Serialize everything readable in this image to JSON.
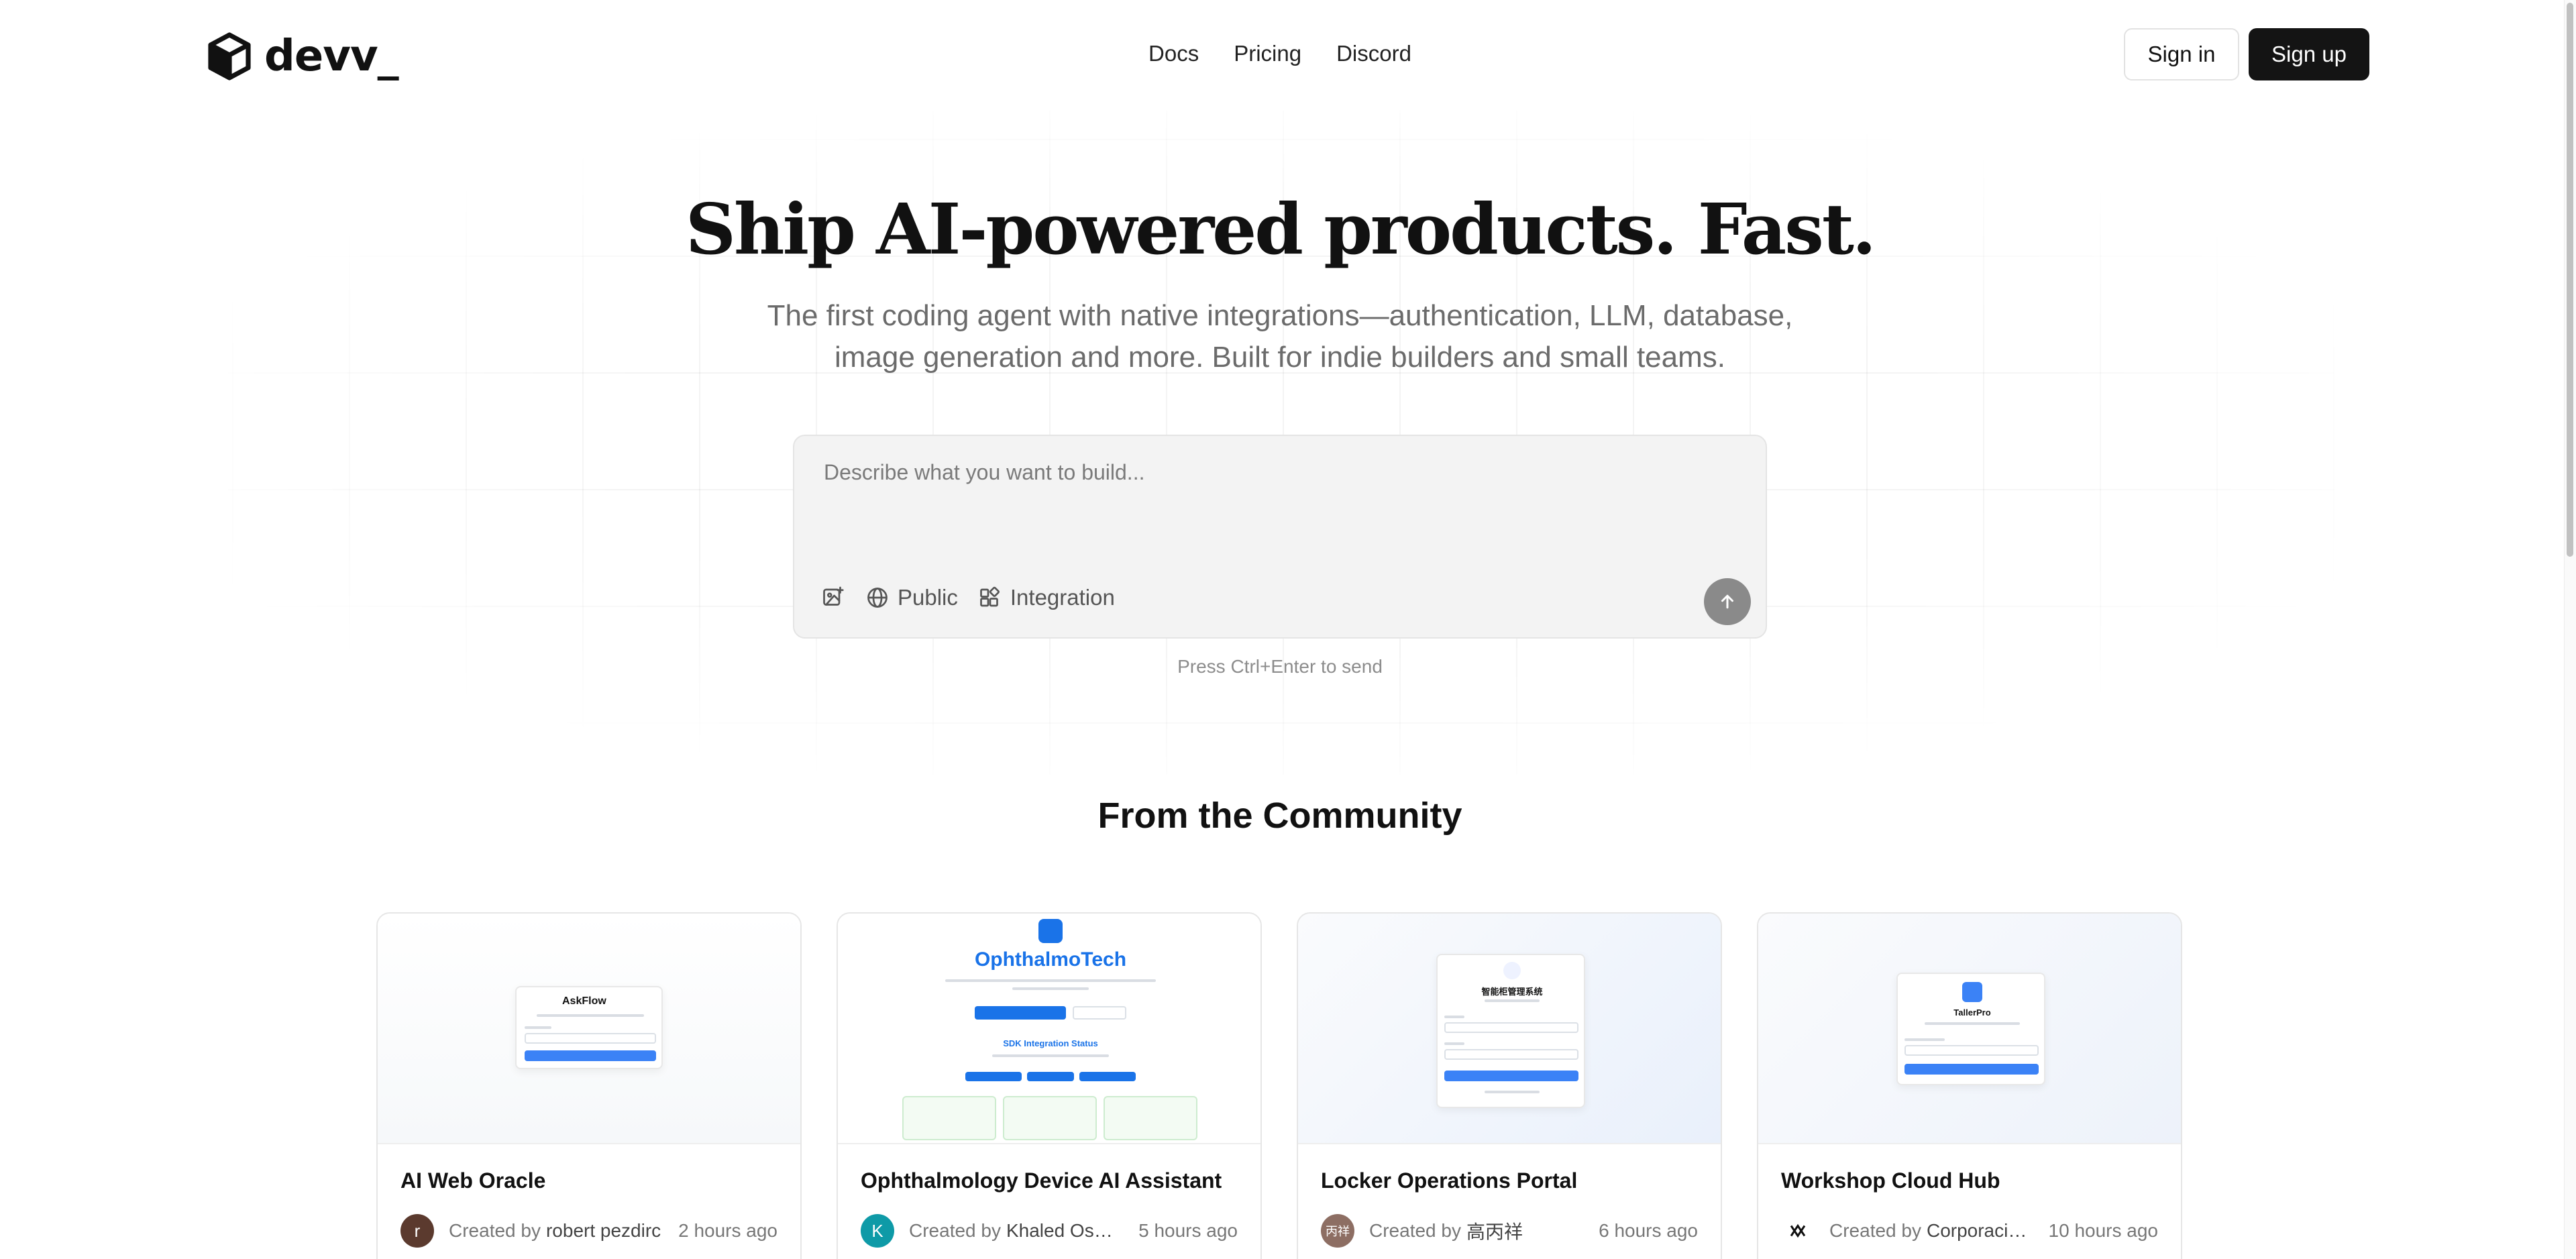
{
  "header": {
    "logo_text": "devv_",
    "nav": [
      "Docs",
      "Pricing",
      "Discord"
    ],
    "sign_in": "Sign in",
    "sign_up": "Sign up"
  },
  "hero": {
    "title": "Ship AI-powered products. Fast.",
    "subtitle_line1": "The first coding agent with native integrations—authentication, LLM, database,",
    "subtitle_line2": "image generation and more. Built for indie builders and small teams."
  },
  "prompt": {
    "placeholder": "Describe what you want to build...",
    "tools": {
      "image_icon": "image-upload-icon",
      "public_label": "Public",
      "integration_label": "Integration"
    },
    "send_icon": "arrow-up-icon",
    "hint": "Press Ctrl+Enter to send"
  },
  "community": {
    "title": "From the Community",
    "cards": [
      {
        "title": "AI Web Oracle",
        "by": "Created by",
        "author": "robert pezdirc",
        "time": "2 hours ago",
        "avatar_letter": "r",
        "avatar_color": "#5b3a2e",
        "preview_name": "AskFlow"
      },
      {
        "title": "Ophthalmology Device AI Assistant",
        "by": "Created by",
        "author": "Khaled Osman",
        "time": "5 hours ago",
        "avatar_letter": "K",
        "avatar_color": "#0e9aa7",
        "preview_name": "OphthalmoTech",
        "preview_sub": "SDK Integration Status"
      },
      {
        "title": "Locker Operations Portal",
        "by": "Created by",
        "author": "高丙祥",
        "time": "6 hours ago",
        "avatar_letter": "丙祥",
        "avatar_color": "#8d6e63",
        "preview_name": "智能柜管理系统"
      },
      {
        "title": "Workshop Cloud Hub",
        "by": "Created by",
        "author": "Corporación...",
        "time": "10 hours ago",
        "avatar_letter": "",
        "avatar_color": "#ffffff",
        "preview_name": "TallerPro"
      }
    ]
  },
  "colors": {
    "primary_button": "#141414",
    "accent_blue": "#1a73e8",
    "send_button": "#8a8a8a"
  }
}
